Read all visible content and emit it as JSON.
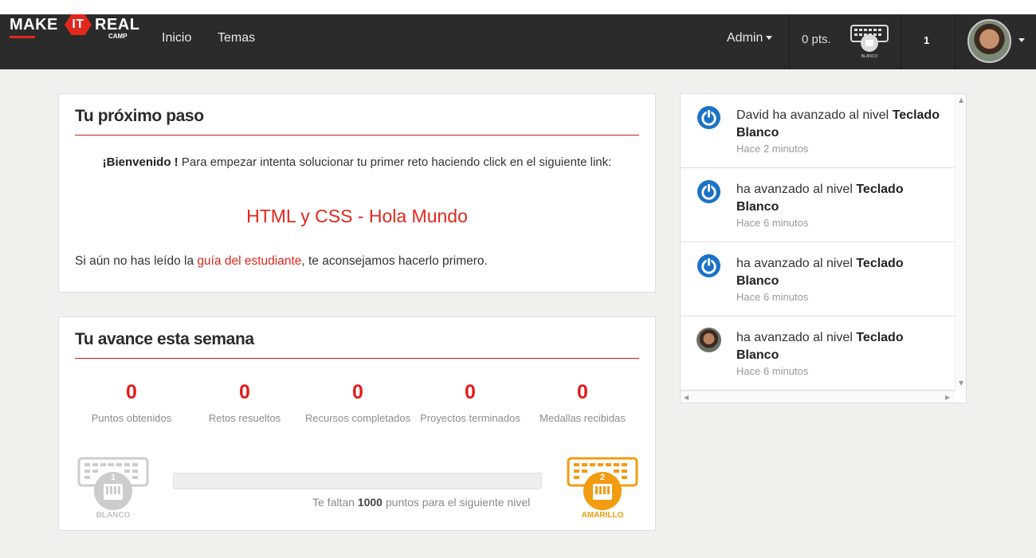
{
  "nav": {
    "logo": {
      "make": "MAKE",
      "it": "IT",
      "real": "REAL",
      "camp": "CAMP"
    },
    "links": [
      "Inicio",
      "Temas"
    ],
    "admin_label": "Admin",
    "points": "0 pts.",
    "level_badge_label": "BLANCO",
    "notification_count": "1"
  },
  "next_step": {
    "title": "Tu próximo paso",
    "welcome_bold": "¡Bienvenido !",
    "welcome_text": " Para empezar intenta solucionar tu primer reto haciendo click en el siguiente link:",
    "challenge_link": "HTML y CSS - Hola Mundo",
    "guide_prefix": "Si aún no has leído la ",
    "guide_link": "guía del estudiante",
    "guide_suffix": ", te aconsejamos hacerlo primero."
  },
  "week_progress": {
    "title": "Tu avance esta semana",
    "stats": [
      {
        "value": "0",
        "label": "Puntos obtenidos"
      },
      {
        "value": "0",
        "label": "Retos resueltos"
      },
      {
        "value": "0",
        "label": "Recursos completados"
      },
      {
        "value": "0",
        "label": "Proyectos terminados"
      },
      {
        "value": "0",
        "label": "Medallas recibidas"
      }
    ],
    "progress_fraction": 0,
    "remaining_prefix": "Te faltan ",
    "remaining_points": "1000",
    "remaining_suffix": " puntos para el siguiente nivel",
    "current_level": {
      "number": "1",
      "name": "BLANCO",
      "color": "#cccccc"
    },
    "next_level": {
      "number": "2",
      "name": "AMARILLO",
      "color": "#f39c12"
    }
  },
  "feed": {
    "items": [
      {
        "actor": "David",
        "text": " ha avanzado al nivel ",
        "level": "Teclado Blanco",
        "time": "Hace 2 minutos",
        "icon": "power-icon"
      },
      {
        "actor": "",
        "text": "ha avanzado al nivel ",
        "level": "Teclado Blanco",
        "time": "Hace 6 minutos",
        "icon": "power-icon"
      },
      {
        "actor": "",
        "text": "ha avanzado al nivel ",
        "level": "Teclado Blanco",
        "time": "Hace 6 minutos",
        "icon": "power-icon"
      },
      {
        "actor": "",
        "text": "ha avanzado al nivel ",
        "level": "Teclado Blanco",
        "time": "Hace 6 minutos",
        "icon": "user-avatar"
      }
    ]
  },
  "colors": {
    "accent": "#e0281c",
    "navbar": "#2b2b2b",
    "power_icon": "#1b73c6"
  }
}
